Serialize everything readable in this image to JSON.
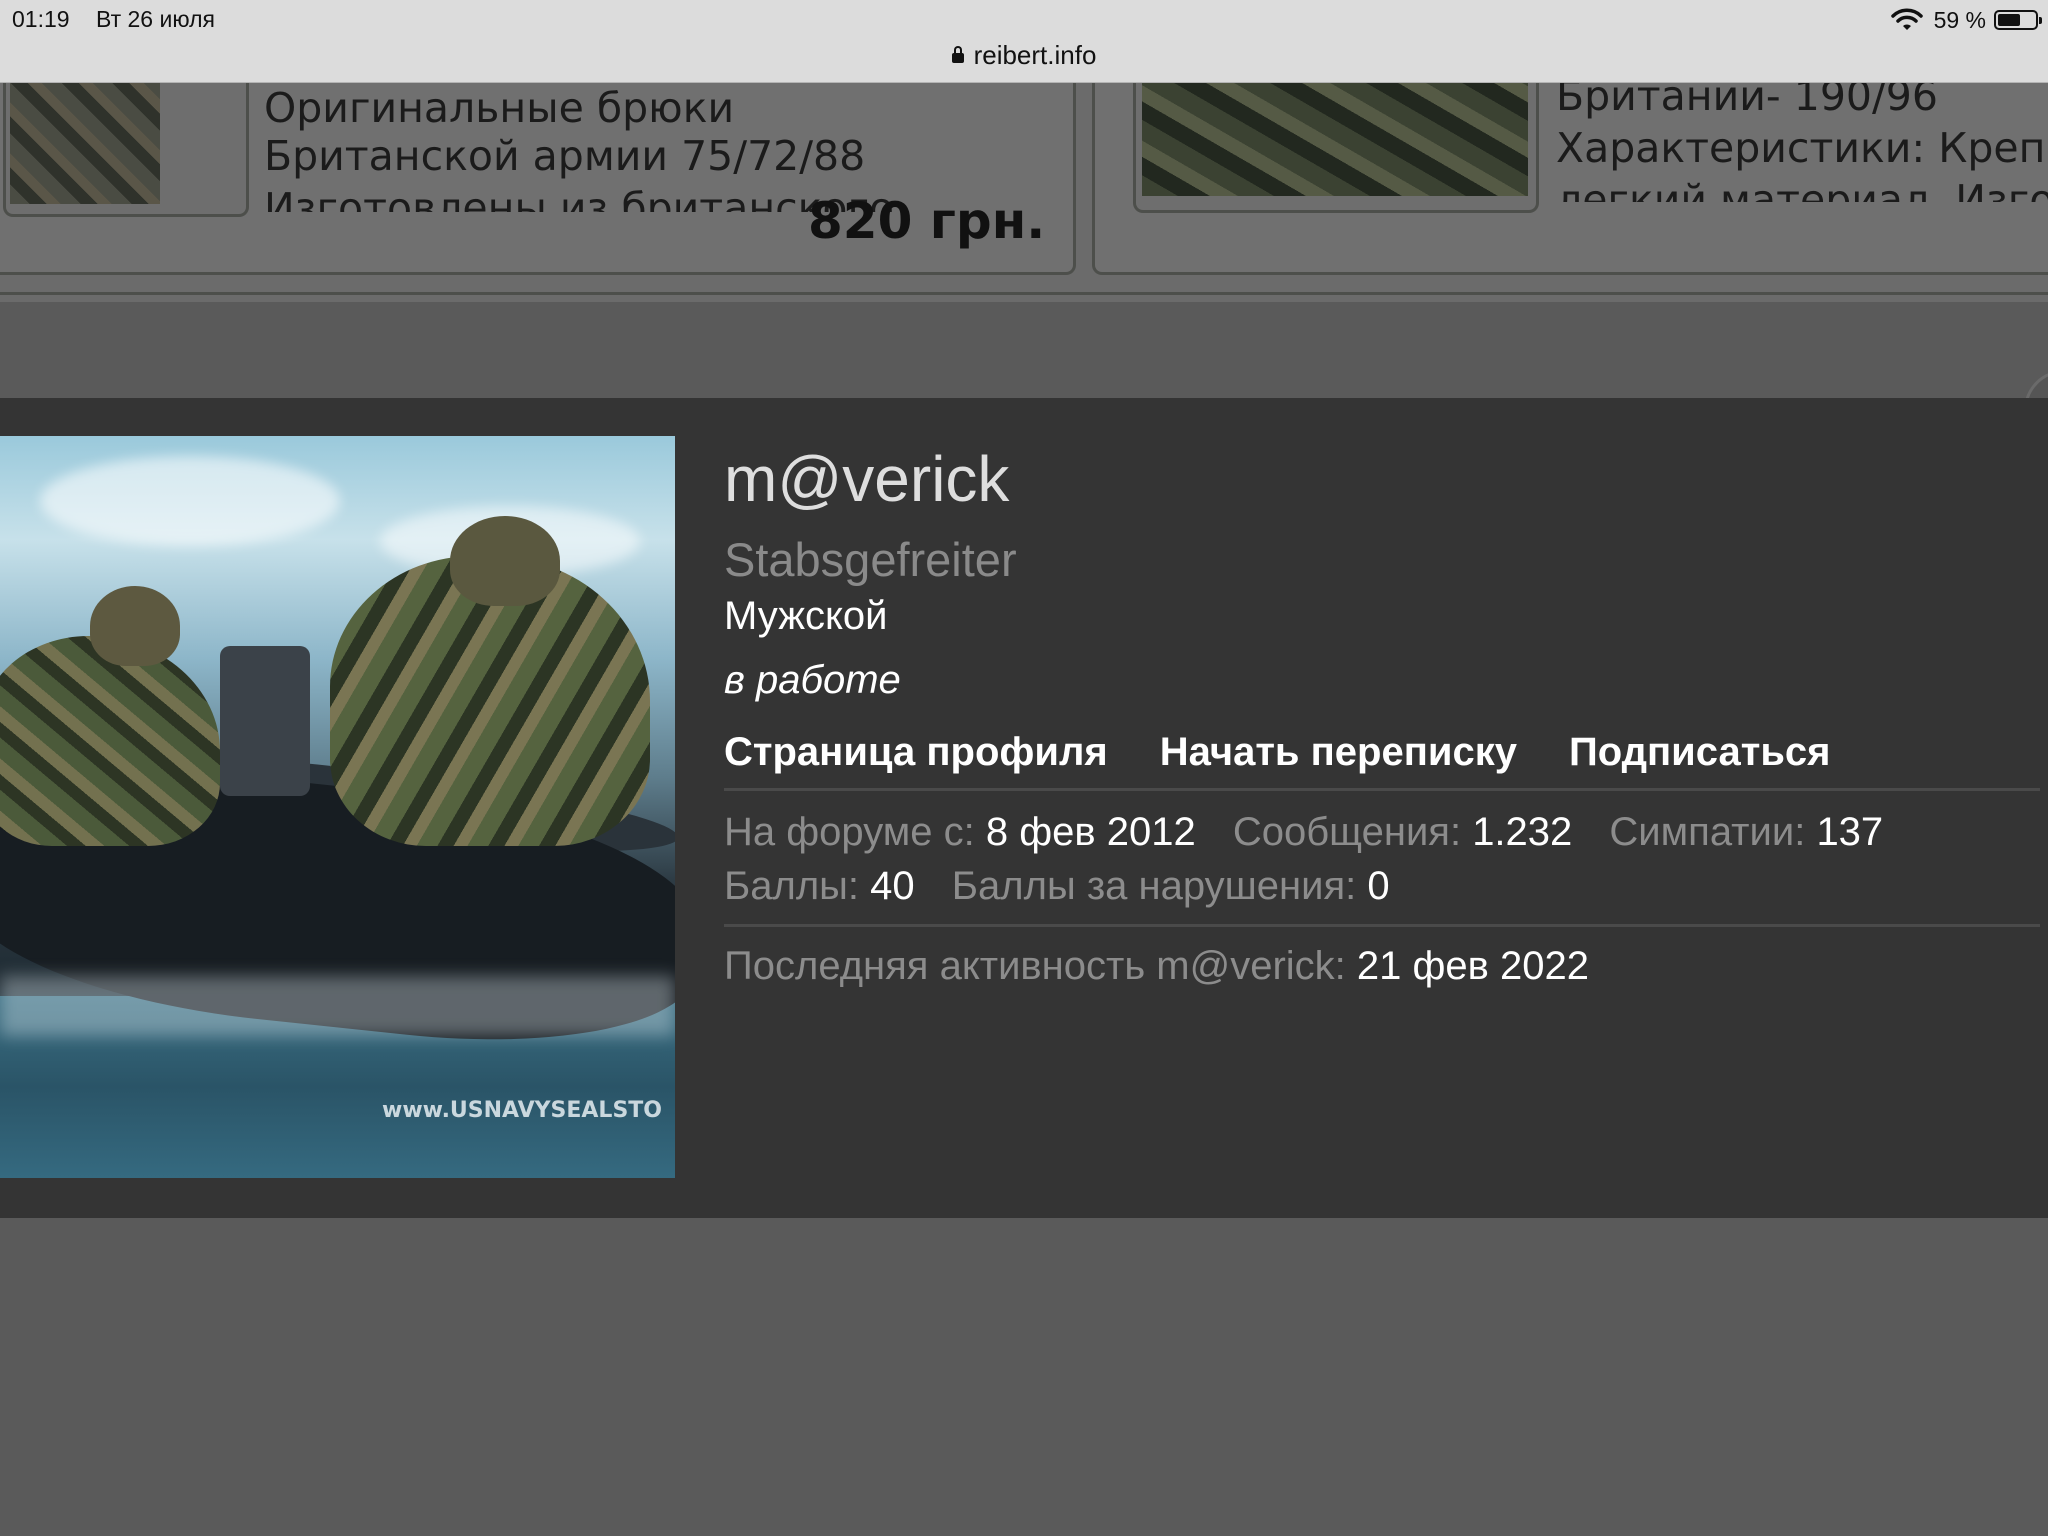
{
  "status_bar": {
    "time": "01:19",
    "date": "Вт 26 июля",
    "url": "reibert.info",
    "battery": "59 %"
  },
  "background": {
    "card_left": {
      "line1": "Оригинальные брюки",
      "line2": "Британской армии 75/72/88",
      "line3": "Изготовлены из британского",
      "price": "820 грн."
    },
    "card_right": {
      "line1": "Британии- 190/96",
      "line2": "Характеристики: Креп",
      "line3": "легкий материал. Изго"
    }
  },
  "profile": {
    "avatar_watermark": "www.USNAVYSEALSTO",
    "username": "m@verick",
    "rank": "Stabsgefreiter",
    "gender": "Мужской",
    "status": "в работе",
    "actions": {
      "profile_page": "Страница профиля",
      "start_conversation": "Начать переписку",
      "follow": "Подписаться"
    },
    "stats": {
      "joined_label": "На форуме с:",
      "joined_value": "8 фев 2012",
      "messages_label": "Сообщения:",
      "messages_value": "1.232",
      "likes_label": "Симпатии:",
      "likes_value": "137",
      "points_label": "Баллы:",
      "points_value": "40",
      "warning_label": "Баллы за нарушения:",
      "warning_value": "0"
    },
    "last_activity": {
      "label": "Последняя активность m@verick:",
      "value": "21 фев 2022"
    }
  }
}
